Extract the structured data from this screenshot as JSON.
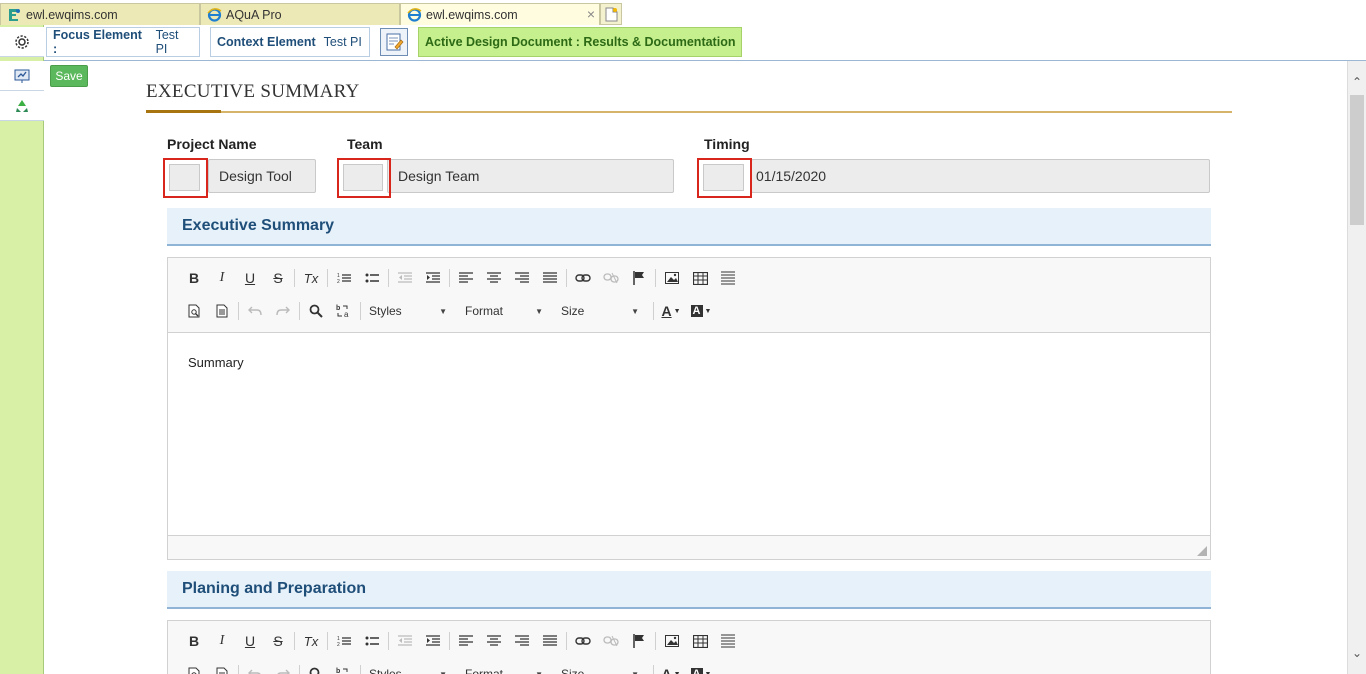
{
  "browser": {
    "tabs": [
      {
        "label": "ewl.ewqims.com",
        "icon": "ewl-logo-icon"
      },
      {
        "label": "AQuA Pro",
        "icon": "ie-icon"
      },
      {
        "label": "ewl.ewqims.com",
        "icon": "ie-icon",
        "active": true
      }
    ],
    "close_glyph": "×"
  },
  "topbar": {
    "focus_label": "Focus Element :",
    "focus_value": "Test PI",
    "context_label": "Context Element",
    "context_value": "Test PI",
    "active_doc": "Active Design Document : Results & Documentation"
  },
  "content": {
    "save_label": "Save",
    "page_title": "EXECUTIVE SUMMARY",
    "fields": {
      "project_name_label": "Project Name",
      "project_name_value": "Design Tool",
      "team_label": "Team",
      "team_value": "Design Team",
      "timing_label": "Timing",
      "timing_value": "01/15/2020"
    },
    "sections": [
      {
        "title": "Executive Summary",
        "body": "Summary"
      },
      {
        "title": "Planing and Preparation",
        "body": ""
      }
    ],
    "editor_toolbar": {
      "bold": "B",
      "italic": "I",
      "underline": "U",
      "strike": "S",
      "clear_format": "Tx",
      "styles": "Styles",
      "format": "Format",
      "size": "Size",
      "font_color": "A",
      "bg_color": "A",
      "arrow": "▼"
    }
  },
  "colors": {
    "rail_green": "#d8f0a6",
    "active_doc_bg": "#c6ef8e",
    "save_green": "#5cb85c",
    "section_blue": "#1f4e79",
    "highlight_red": "#d9261c",
    "title_gold": "#a8740f"
  }
}
